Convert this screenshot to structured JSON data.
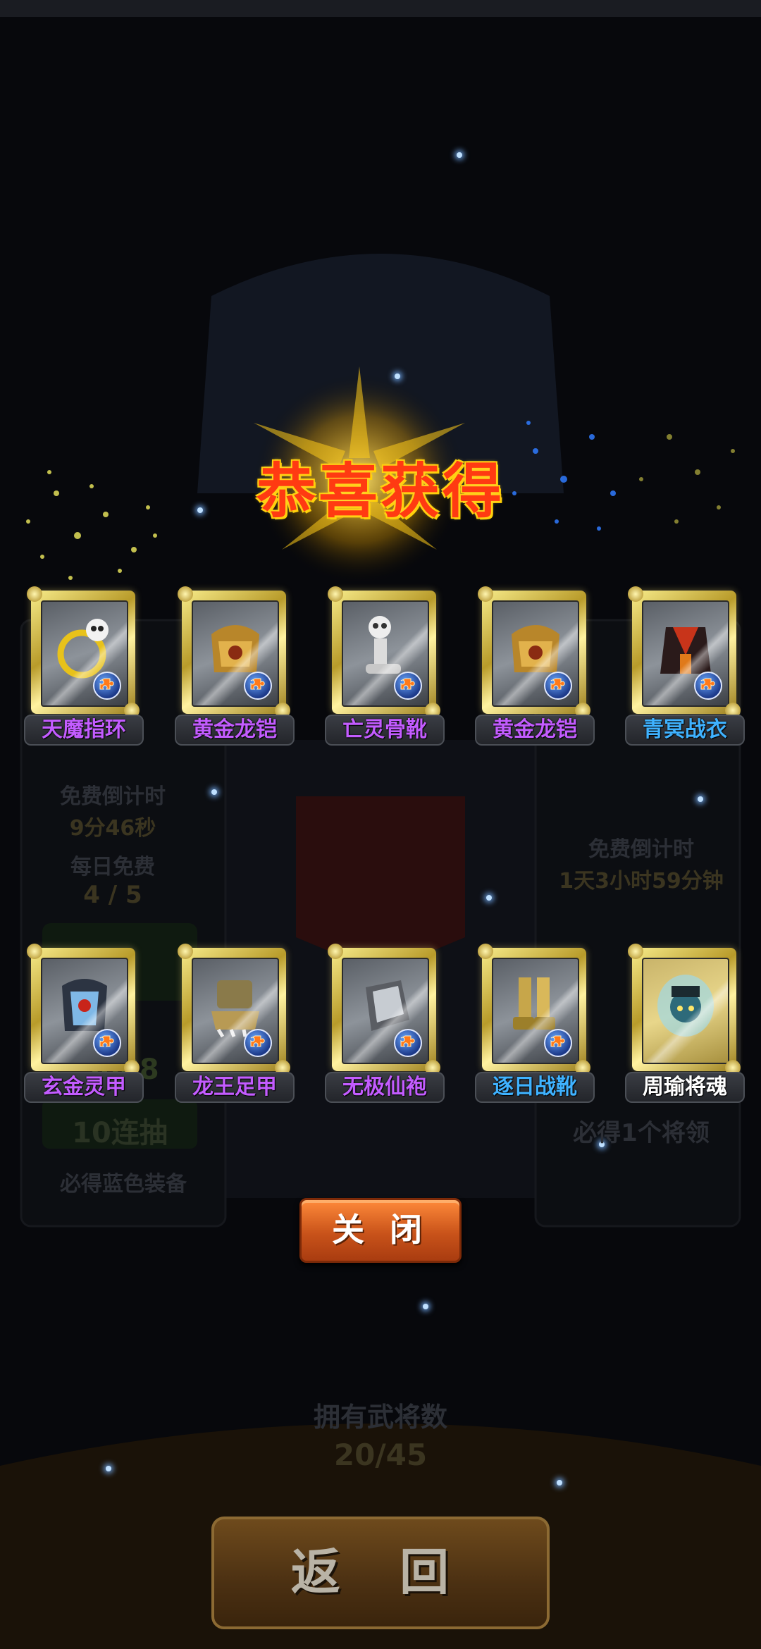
{
  "dialog": {
    "title": "恭喜获得",
    "close_label": "关 闭"
  },
  "items": [
    {
      "name": "天魔指环",
      "quality": "purple",
      "icon": "ring-icon"
    },
    {
      "name": "黄金龙铠",
      "quality": "purple",
      "icon": "golden-armor-icon"
    },
    {
      "name": "亡灵骨靴",
      "quality": "purple",
      "icon": "bone-boots-icon"
    },
    {
      "name": "黄金龙铠",
      "quality": "purple",
      "icon": "golden-armor-icon"
    },
    {
      "name": "青冥战衣",
      "quality": "blue",
      "icon": "battle-robe-icon"
    },
    {
      "name": "玄金灵甲",
      "quality": "purple",
      "icon": "spirit-armor-icon"
    },
    {
      "name": "龙王足甲",
      "quality": "purple",
      "icon": "claw-boots-icon"
    },
    {
      "name": "无极仙袍",
      "quality": "purple",
      "icon": "gauntlet-icon"
    },
    {
      "name": "逐日战靴",
      "quality": "blue",
      "icon": "war-boots-icon"
    },
    {
      "name": "周瑜将魂",
      "quality": "white",
      "icon": "general-soul-icon"
    }
  ],
  "background": {
    "free_countdown_label": "免费倒计时",
    "free_countdown_left": "9分46秒",
    "daily_free_label": "每日免费",
    "daily_free_count": "4 / 5",
    "ten_draw_cost": "3888",
    "ten_draw_label": "10连抽",
    "guarantee_blue": "必得蓝色装备",
    "free_countdown_right": "1天3小时59分钟",
    "guarantee_general": "必得1个将领",
    "generals_owned_label": "拥有武将数",
    "generals_owned_value": "20/45",
    "back_label": "返 回"
  },
  "colors": {
    "purple": "#c35cff",
    "blue": "#3fb2ff",
    "white": "#ffffff",
    "title": "#ff3a12"
  }
}
